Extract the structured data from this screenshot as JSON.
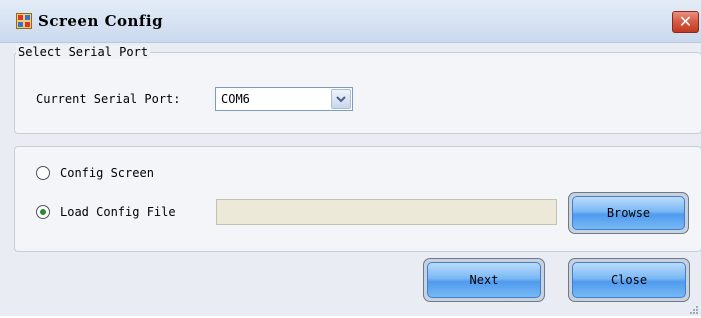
{
  "window": {
    "title": "Screen Config",
    "close_glyph": "✕",
    "app_icon": "app-window-icon"
  },
  "serial_group": {
    "legend": "Select Serial Port",
    "port_label": "Current Serial Port:",
    "port_value": "COM6",
    "dropdown_icon": "chevron-down-icon"
  },
  "mode_group": {
    "options": [
      {
        "label": "Config Screen",
        "selected": false
      },
      {
        "label": "Load Config File",
        "selected": true
      }
    ],
    "file_path": "",
    "browse_label": "Browse"
  },
  "footer": {
    "next_label": "Next",
    "close_label": "Close"
  },
  "colors": {
    "accent": "#4f9bee",
    "close_red": "#c0391f",
    "radio_selected": "#2a8a2a"
  }
}
